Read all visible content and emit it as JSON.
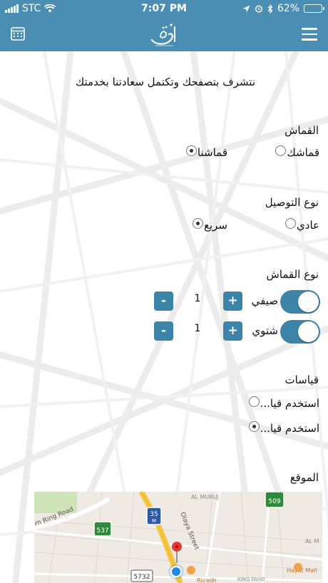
{
  "status_bar": {
    "carrier": "STC",
    "time": "7:07 PM",
    "battery": "62%",
    "battery_level": 0.62
  },
  "nav": {
    "calendar_icon": "calendar-icon",
    "menu_icon": "hamburger-menu-icon",
    "logo": "app-logo"
  },
  "welcome_text": "نتشرف بتصفحك وتكتمل سعادتنا بخدمتك",
  "fabric_section": {
    "title": "القماش",
    "options": [
      {
        "label": "قماشك",
        "selected": false
      },
      {
        "label": "قماشنا",
        "selected": true
      }
    ]
  },
  "delivery_section": {
    "title": "نوع التوصيل",
    "options": [
      {
        "label": "عادي",
        "selected": false
      },
      {
        "label": "سريع",
        "selected": true
      }
    ]
  },
  "fabric_type_section": {
    "title": "نوع القماش",
    "items": [
      {
        "label": "صيفي",
        "enabled": true,
        "quantity": "1",
        "plus": "+",
        "minus": "-"
      },
      {
        "label": "شتوي",
        "enabled": true,
        "quantity": "1",
        "plus": "+",
        "minus": "-"
      }
    ]
  },
  "measurements_section": {
    "title": "قياسات",
    "options": [
      {
        "label": "استخدم قيا...",
        "selected": false
      },
      {
        "label": "استخدم قيا...",
        "selected": true
      }
    ]
  },
  "location_section": {
    "title": "الموقع"
  },
  "map": {
    "labels": {
      "ring_road": "rn Ring Road",
      "olaya": "Olaya Street",
      "al_muroos": "AL MURUJ",
      "al_m": "AL M",
      "king_fahd": "KING FAHD",
      "hayat_mall": "Hayat Mall",
      "riyadh": "Riyadh"
    },
    "shields": [
      "537",
      "35",
      "M",
      "509",
      "5732"
    ],
    "colors": {
      "highway": "#f6c645",
      "pin": "#e53935",
      "location": "#1e88e5",
      "park": "#cfe5b8"
    }
  }
}
